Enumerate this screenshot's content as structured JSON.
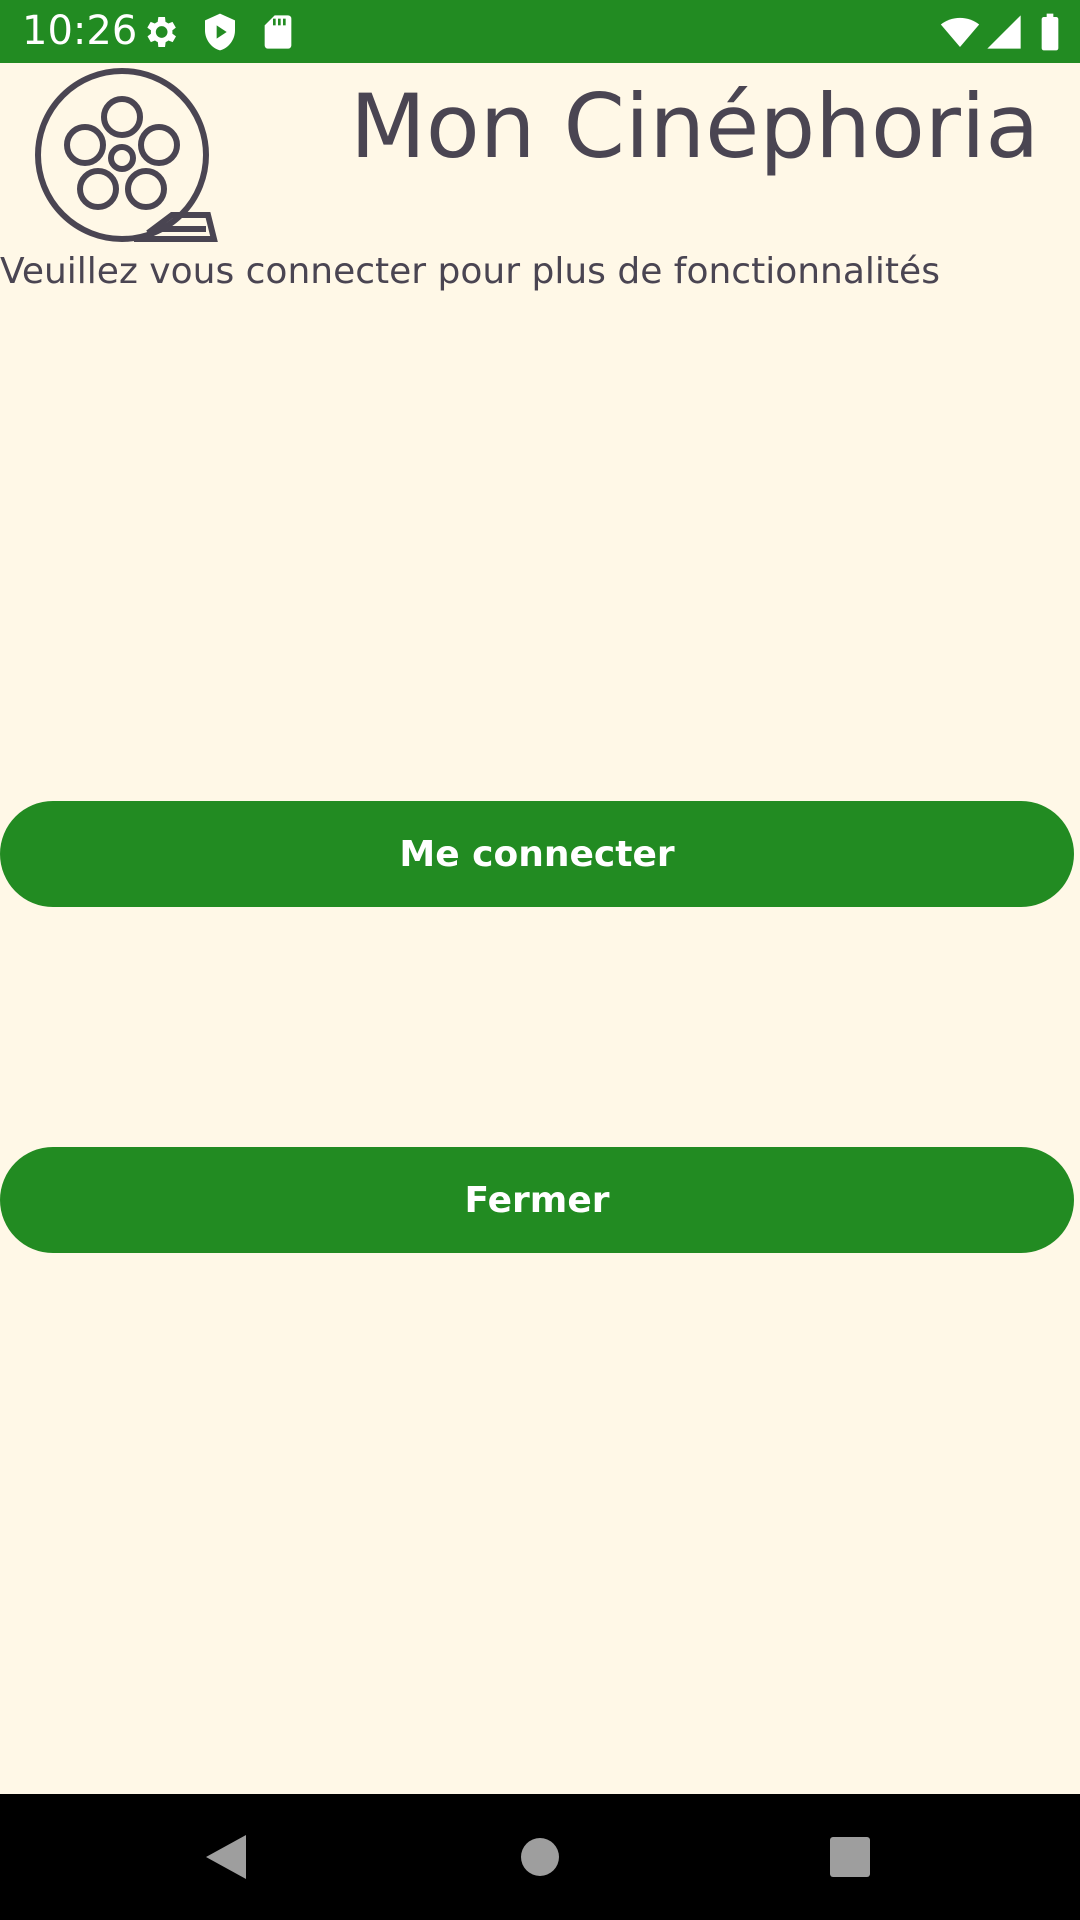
{
  "status_bar": {
    "time": "10:26",
    "background_color": "#228B22",
    "left_icons": [
      "settings-icon",
      "shield-play-icon",
      "sd-card-icon"
    ],
    "right_icons": [
      "wifi-icon",
      "cell-signal-icon",
      "battery-icon"
    ]
  },
  "header": {
    "title": "Mon Cinéphoria",
    "logo_icon": "film-reel-icon"
  },
  "main": {
    "subtitle": "Veuillez vous connecter pour plus de fonctionnalités",
    "login_button_label": "Me connecter",
    "close_button_label": "Fermer",
    "accent_color": "#228B22",
    "background_color": "#FFF8E7"
  },
  "nav_bar": {
    "icons": [
      "back-icon",
      "home-icon",
      "recents-icon"
    ]
  }
}
